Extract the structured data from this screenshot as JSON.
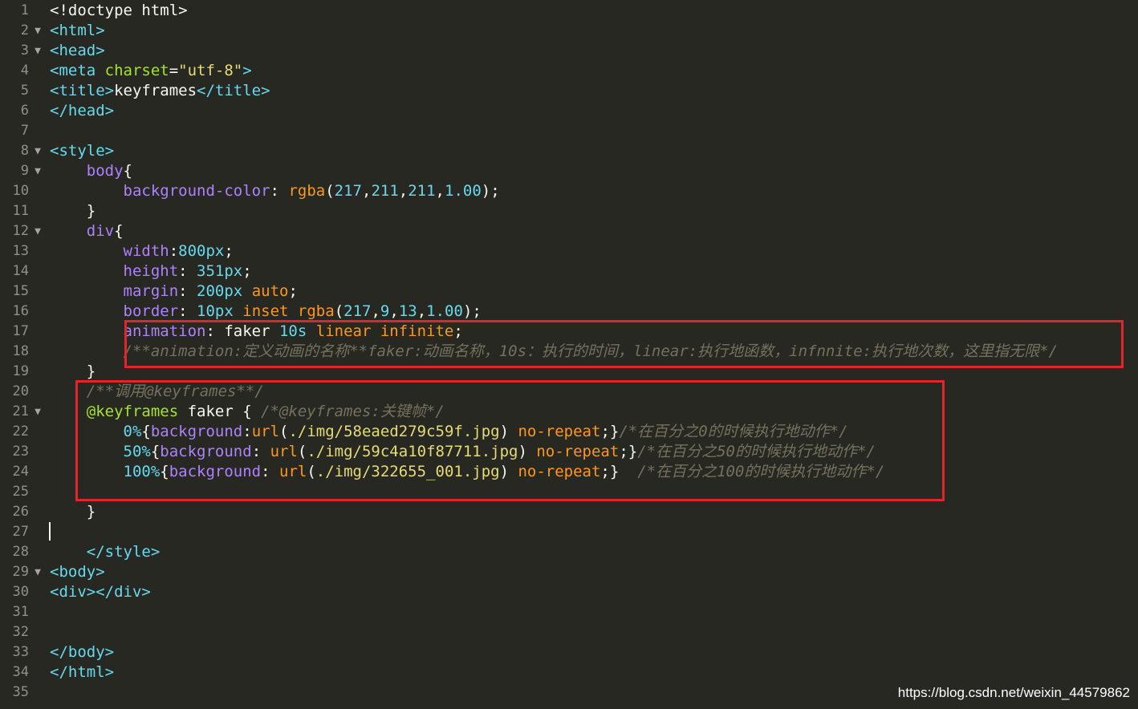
{
  "editor": {
    "lines": [
      {
        "num": "1",
        "fold": "",
        "segments": [
          {
            "c": "plain",
            "t": "<!doctype html>"
          }
        ]
      },
      {
        "num": "2",
        "fold": "▼",
        "segments": [
          {
            "c": "tag",
            "t": "<html>"
          }
        ]
      },
      {
        "num": "3",
        "fold": "▼",
        "segments": [
          {
            "c": "tag",
            "t": "<head>"
          }
        ]
      },
      {
        "num": "4",
        "fold": "",
        "segments": [
          {
            "c": "tag",
            "t": "<meta "
          },
          {
            "c": "attr",
            "t": "charset"
          },
          {
            "c": "plain",
            "t": "="
          },
          {
            "c": "str",
            "t": "\"utf-8\""
          },
          {
            "c": "tag",
            "t": ">"
          }
        ]
      },
      {
        "num": "5",
        "fold": "",
        "segments": [
          {
            "c": "tag",
            "t": "<title>"
          },
          {
            "c": "plain",
            "t": "keyframes"
          },
          {
            "c": "tag",
            "t": "</title>"
          }
        ]
      },
      {
        "num": "6",
        "fold": "",
        "segments": [
          {
            "c": "tag",
            "t": "</head>"
          }
        ]
      },
      {
        "num": "7",
        "fold": "",
        "segments": []
      },
      {
        "num": "8",
        "fold": "▼",
        "segments": [
          {
            "c": "tag",
            "t": "<style>"
          }
        ]
      },
      {
        "num": "9",
        "fold": "▼",
        "segments": [
          {
            "c": "plain",
            "t": "    "
          },
          {
            "c": "prop",
            "t": "body"
          },
          {
            "c": "plain",
            "t": "{"
          }
        ]
      },
      {
        "num": "10",
        "fold": "",
        "segments": [
          {
            "c": "plain",
            "t": "        "
          },
          {
            "c": "prop",
            "t": "background-color"
          },
          {
            "c": "plain",
            "t": ": "
          },
          {
            "c": "val",
            "t": "rgba"
          },
          {
            "c": "plain",
            "t": "("
          },
          {
            "c": "num",
            "t": "217"
          },
          {
            "c": "plain",
            "t": ","
          },
          {
            "c": "num",
            "t": "211"
          },
          {
            "c": "plain",
            "t": ","
          },
          {
            "c": "num",
            "t": "211"
          },
          {
            "c": "plain",
            "t": ","
          },
          {
            "c": "num",
            "t": "1.00"
          },
          {
            "c": "plain",
            "t": ");"
          }
        ]
      },
      {
        "num": "11",
        "fold": "",
        "segments": [
          {
            "c": "plain",
            "t": "    }"
          }
        ]
      },
      {
        "num": "12",
        "fold": "▼",
        "segments": [
          {
            "c": "plain",
            "t": "    "
          },
          {
            "c": "prop",
            "t": "div"
          },
          {
            "c": "plain",
            "t": "{"
          }
        ]
      },
      {
        "num": "13",
        "fold": "",
        "segments": [
          {
            "c": "plain",
            "t": "        "
          },
          {
            "c": "prop",
            "t": "width"
          },
          {
            "c": "plain",
            "t": ":"
          },
          {
            "c": "num",
            "t": "800px"
          },
          {
            "c": "plain",
            "t": ";"
          }
        ]
      },
      {
        "num": "14",
        "fold": "",
        "segments": [
          {
            "c": "plain",
            "t": "        "
          },
          {
            "c": "prop",
            "t": "height"
          },
          {
            "c": "plain",
            "t": ": "
          },
          {
            "c": "num",
            "t": "351px"
          },
          {
            "c": "plain",
            "t": ";"
          }
        ]
      },
      {
        "num": "15",
        "fold": "",
        "segments": [
          {
            "c": "plain",
            "t": "        "
          },
          {
            "c": "prop",
            "t": "margin"
          },
          {
            "c": "plain",
            "t": ": "
          },
          {
            "c": "num",
            "t": "200px"
          },
          {
            "c": "plain",
            "t": " "
          },
          {
            "c": "val",
            "t": "auto"
          },
          {
            "c": "plain",
            "t": ";"
          }
        ]
      },
      {
        "num": "16",
        "fold": "",
        "segments": [
          {
            "c": "plain",
            "t": "        "
          },
          {
            "c": "prop",
            "t": "border"
          },
          {
            "c": "plain",
            "t": ": "
          },
          {
            "c": "num",
            "t": "10px"
          },
          {
            "c": "plain",
            "t": " "
          },
          {
            "c": "val",
            "t": "inset"
          },
          {
            "c": "plain",
            "t": " "
          },
          {
            "c": "val",
            "t": "rgba"
          },
          {
            "c": "plain",
            "t": "("
          },
          {
            "c": "num",
            "t": "217"
          },
          {
            "c": "plain",
            "t": ","
          },
          {
            "c": "num",
            "t": "9"
          },
          {
            "c": "plain",
            "t": ","
          },
          {
            "c": "num",
            "t": "13"
          },
          {
            "c": "plain",
            "t": ","
          },
          {
            "c": "num",
            "t": "1.00"
          },
          {
            "c": "plain",
            "t": ");"
          }
        ]
      },
      {
        "num": "17",
        "fold": "",
        "segments": [
          {
            "c": "plain",
            "t": "        "
          },
          {
            "c": "prop",
            "t": "animation"
          },
          {
            "c": "plain",
            "t": ": faker "
          },
          {
            "c": "num",
            "t": "10s"
          },
          {
            "c": "plain",
            "t": " "
          },
          {
            "c": "val",
            "t": "linear"
          },
          {
            "c": "plain",
            "t": " "
          },
          {
            "c": "val",
            "t": "infinite"
          },
          {
            "c": "plain",
            "t": ";"
          }
        ]
      },
      {
        "num": "18",
        "fold": "",
        "segments": [
          {
            "c": "plain",
            "t": "        "
          },
          {
            "c": "com",
            "t": "/**animation:定义动画的名称**faker:动画名称，10s：执行的时间，linear:执行地函数，infnnite:执行地次数，这里指无限*/"
          }
        ]
      },
      {
        "num": "19",
        "fold": "",
        "segments": [
          {
            "c": "plain",
            "t": "    }"
          }
        ]
      },
      {
        "num": "20",
        "fold": "",
        "segments": [
          {
            "c": "plain",
            "t": "    "
          },
          {
            "c": "com",
            "t": "/**调用@keyframes**/"
          }
        ]
      },
      {
        "num": "21",
        "fold": "▼",
        "segments": [
          {
            "c": "plain",
            "t": "    "
          },
          {
            "c": "kw",
            "t": "@keyframes"
          },
          {
            "c": "plain",
            "t": " faker { "
          },
          {
            "c": "com",
            "t": "/*@keyframes:关键帧*/"
          }
        ]
      },
      {
        "num": "22",
        "fold": "",
        "segments": [
          {
            "c": "plain",
            "t": "        "
          },
          {
            "c": "pct",
            "t": "0%"
          },
          {
            "c": "plain",
            "t": "{"
          },
          {
            "c": "prop",
            "t": "background"
          },
          {
            "c": "plain",
            "t": ":"
          },
          {
            "c": "val",
            "t": "url"
          },
          {
            "c": "plain",
            "t": "("
          },
          {
            "c": "str",
            "t": "./img/58eaed279c59f.jpg"
          },
          {
            "c": "plain",
            "t": ") "
          },
          {
            "c": "val",
            "t": "no-repeat"
          },
          {
            "c": "plain",
            "t": ";}"
          },
          {
            "c": "com",
            "t": "/*在百分之0的时候执行地动作*/"
          }
        ]
      },
      {
        "num": "23",
        "fold": "",
        "segments": [
          {
            "c": "plain",
            "t": "        "
          },
          {
            "c": "pct",
            "t": "50%"
          },
          {
            "c": "plain",
            "t": "{"
          },
          {
            "c": "prop",
            "t": "background"
          },
          {
            "c": "plain",
            "t": ": "
          },
          {
            "c": "val",
            "t": "url"
          },
          {
            "c": "plain",
            "t": "("
          },
          {
            "c": "str",
            "t": "./img/59c4a10f87711.jpg"
          },
          {
            "c": "plain",
            "t": ") "
          },
          {
            "c": "val",
            "t": "no-repeat"
          },
          {
            "c": "plain",
            "t": ";}"
          },
          {
            "c": "com",
            "t": "/*在百分之50的时候执行地动作*/"
          }
        ]
      },
      {
        "num": "24",
        "fold": "",
        "segments": [
          {
            "c": "plain",
            "t": "        "
          },
          {
            "c": "pct",
            "t": "100%"
          },
          {
            "c": "plain",
            "t": "{"
          },
          {
            "c": "prop",
            "t": "background"
          },
          {
            "c": "plain",
            "t": ": "
          },
          {
            "c": "val",
            "t": "url"
          },
          {
            "c": "plain",
            "t": "("
          },
          {
            "c": "str",
            "t": "./img/322655_001.jpg"
          },
          {
            "c": "plain",
            "t": ") "
          },
          {
            "c": "val",
            "t": "no-repeat"
          },
          {
            "c": "plain",
            "t": ";}  "
          },
          {
            "c": "com",
            "t": "/*在百分之100的时候执行地动作*/"
          }
        ]
      },
      {
        "num": "25",
        "fold": "",
        "segments": []
      },
      {
        "num": "26",
        "fold": "",
        "segments": [
          {
            "c": "plain",
            "t": "    }"
          }
        ]
      },
      {
        "num": "27",
        "fold": "",
        "segments": []
      },
      {
        "num": "28",
        "fold": "",
        "segments": [
          {
            "c": "plain",
            "t": "    "
          },
          {
            "c": "tag",
            "t": "</style>"
          }
        ]
      },
      {
        "num": "29",
        "fold": "▼",
        "segments": [
          {
            "c": "tag",
            "t": "<body>"
          }
        ]
      },
      {
        "num": "30",
        "fold": "",
        "segments": [
          {
            "c": "tag",
            "t": "<div></div>"
          }
        ]
      },
      {
        "num": "31",
        "fold": "",
        "segments": []
      },
      {
        "num": "32",
        "fold": "",
        "segments": []
      },
      {
        "num": "33",
        "fold": "",
        "segments": [
          {
            "c": "tag",
            "t": "</body>"
          }
        ]
      },
      {
        "num": "34",
        "fold": "",
        "segments": [
          {
            "c": "tag",
            "t": "</html>"
          }
        ]
      },
      {
        "num": "35",
        "fold": "",
        "segments": []
      }
    ]
  },
  "watermark": "https://blog.csdn.net/weixin_44579862",
  "colors": {
    "background": "#272822",
    "highlight_border": "#e0262b",
    "gutter_text": "#8f908a"
  }
}
